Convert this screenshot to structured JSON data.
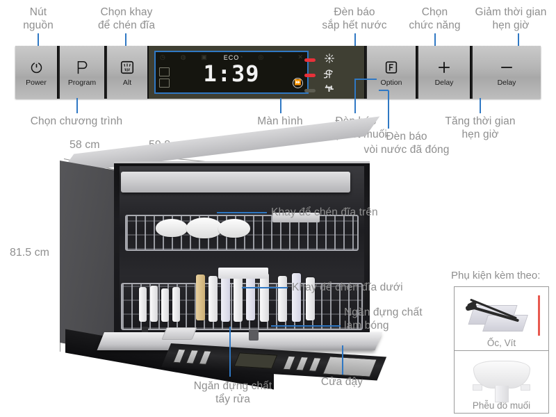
{
  "control_panel": {
    "buttons": [
      {
        "glyph": "⏻",
        "icon_name": "power-icon",
        "label": "Power"
      },
      {
        "glyph": "P",
        "icon_name": "program-icon",
        "label": "Program"
      },
      {
        "glyph": "⛆",
        "icon_name": "spray-arm-icon",
        "label": "Alt"
      },
      {
        "glyph": "F",
        "icon_name": "function-icon",
        "label": "Option"
      },
      {
        "glyph": "+",
        "icon_name": "plus-icon",
        "label": "Delay"
      },
      {
        "glyph": "−",
        "icon_name": "minus-icon",
        "label": "Delay"
      }
    ],
    "display": {
      "program_label": "ECO",
      "time": "1:39",
      "speed_icon": "⏩"
    },
    "indicators": [
      {
        "name": "rinse-aid-indicator",
        "icon": "✳",
        "state": "on"
      },
      {
        "name": "salt-indicator",
        "icon": "⇄",
        "state": "on"
      },
      {
        "name": "water-tap-indicator",
        "icon": "⌁",
        "state": "off"
      }
    ]
  },
  "callouts": {
    "power_button": "Nút\nnguồn",
    "rack_select": "Chọn khay\nđể chén đĩa",
    "low_water_lamp": "Đèn báo\nsắp hết nước",
    "function_select": "Chọn\nchức năng",
    "decrease_timer": "Giảm thời gian\nhẹn giờ",
    "program_select": "Chọn chương trình",
    "screen": "Màn hình",
    "low_salt_lamp": "Đèn báo\nsắp hết muối",
    "increase_timer": "Tăng thời gian\nhẹn giờ",
    "tap_closed_lamp": "Đèn báo\nvòi nước đã đóng",
    "upper_rack": "Khay để chén đĩa trên",
    "lower_rack": "Khay để chén đĩa dưới",
    "rinse_aid_compartment": "Ngăn đựng chất\nlàm bóng",
    "detergent_compartment": "Ngăn đựng chất\ntẩy rửa",
    "door": "Cửa đậy"
  },
  "dimensions": {
    "depth": "58 cm",
    "width": "59.8 cm",
    "height": "81.5 cm"
  },
  "accessories": {
    "title": "Phụ kiện kèm theo:",
    "items": [
      {
        "caption": "Ốc, Vít",
        "icon_name": "screws-image"
      },
      {
        "caption": "Phễu đổ muối",
        "icon_name": "salt-funnel-image"
      }
    ]
  },
  "colors": {
    "leader_line": "#2f78c4",
    "label_text": "#8f8f8f",
    "led_on": "#e8313a",
    "led_off": "#5d5d52",
    "panel_metal": "#b5b5b5"
  }
}
